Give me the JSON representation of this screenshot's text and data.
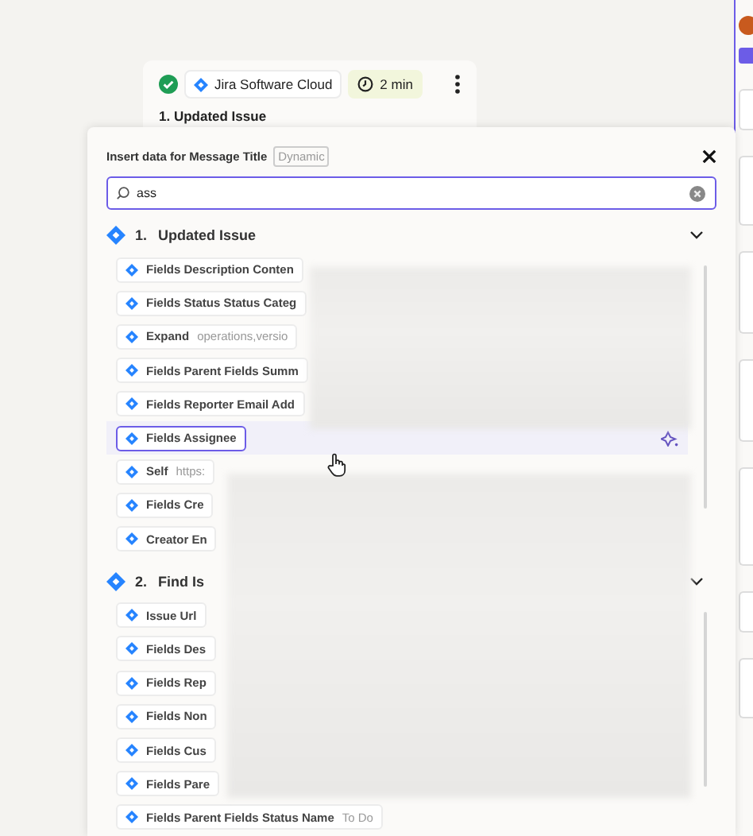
{
  "card": {
    "completed": true,
    "app": "Jira Software Cloud",
    "duration": "2 min",
    "title": "1. Updated Issue"
  },
  "modal": {
    "title": "Insert data for Message Title",
    "tag": "Dynamic",
    "search": {
      "value": "ass"
    },
    "sections": [
      {
        "number": "1.",
        "title": "Updated Issue",
        "expanded": true,
        "items": [
          {
            "label": "Fields Description Conten",
            "selected": false
          },
          {
            "label": "Fields Status Status Categ",
            "selected": false
          },
          {
            "label": "Expand",
            "value": "operations,versio",
            "selected": false
          },
          {
            "label": "Fields Parent Fields Summ",
            "selected": false
          },
          {
            "label": "Fields Reporter Email Add",
            "selected": false
          },
          {
            "label": "Fields Assignee",
            "selected": true
          },
          {
            "label": "Self",
            "value": "https:",
            "selected": false
          },
          {
            "label": "Fields Cre",
            "selected": false
          },
          {
            "label": "Creator En",
            "selected": false
          }
        ]
      },
      {
        "number": "2.",
        "title": "Find Is",
        "expanded": true,
        "items": [
          {
            "label": "Issue Url",
            "selected": false
          },
          {
            "label": "Fields Des",
            "selected": false
          },
          {
            "label": "Fields Rep",
            "selected": false
          },
          {
            "label": "Fields Non",
            "selected": false
          },
          {
            "label": "Fields Cus",
            "selected": false
          },
          {
            "label": "Fields Pare",
            "selected": false
          },
          {
            "label": "Fields Parent Fields Status Name",
            "value": "To Do",
            "selected": false
          }
        ]
      }
    ]
  }
}
